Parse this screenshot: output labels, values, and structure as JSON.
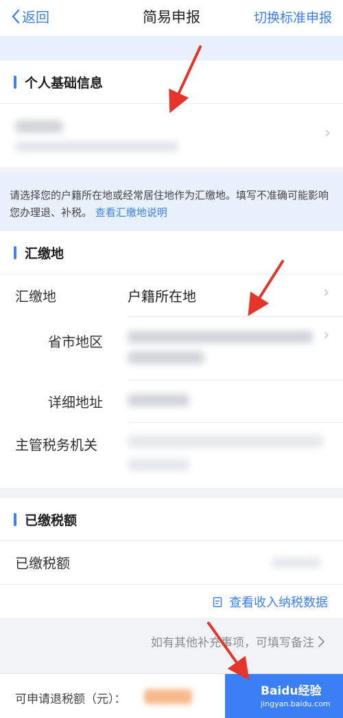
{
  "nav": {
    "back_label": "返回",
    "title": "简易申报",
    "switch_label": "切换标准申报"
  },
  "personal": {
    "section_title": "个人基础信息"
  },
  "notice": {
    "text": "请选择您的户籍所在地或经常居住地作为汇缴地。填写不准确可能影响您办理退、补税。",
    "link": "查看汇缴地说明"
  },
  "huijiao": {
    "section_title": "汇缴地",
    "rows": [
      {
        "label": "汇缴地",
        "value": "户籍所在地"
      },
      {
        "label": "省市地区",
        "value": ""
      },
      {
        "label": "详细地址",
        "value": ""
      },
      {
        "label": "主管税务机关",
        "value": ""
      }
    ]
  },
  "paid": {
    "section_title": "已缴税额",
    "row_label": "已缴税额",
    "income_link": "查看收入纳税数据"
  },
  "remark": {
    "text": "如有其他补充事项，可填写备注"
  },
  "bottom": {
    "refund_label": "可申请退税额（元）：",
    "watermark": "Baidu经验",
    "watermark_sub": "jingyan.baidu.com"
  },
  "colors": {
    "accent": "#3a7ff6",
    "annotation_arrow": "#e5352b",
    "page_bg": "#f2f3f7"
  }
}
